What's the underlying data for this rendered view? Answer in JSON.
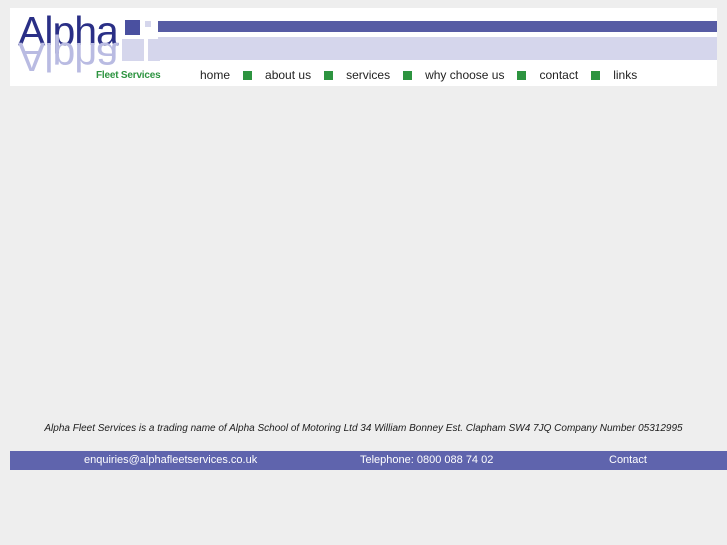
{
  "site": {
    "brand_name": "Alpha",
    "brand_tagline": "Fleet Services",
    "colors": {
      "brand_dark_blue": "#2a2f86",
      "brand_mirror": "#b9bbe2",
      "brand_green": "#2d9440",
      "bar_dark": "#575ca4",
      "bar_light": "#d5d6ec",
      "footer_bar": "#5f64ad",
      "page_background": "#eeeeee",
      "header_background": "#ffffff"
    }
  },
  "nav": {
    "items": [
      {
        "label": "home"
      },
      {
        "label": "about us"
      },
      {
        "label": "services"
      },
      {
        "label": "why choose us"
      },
      {
        "label": "contact"
      },
      {
        "label": "links"
      }
    ],
    "separator_icon": "green-square-icon"
  },
  "main": {
    "content": ""
  },
  "legal": {
    "text": "Alpha Fleet Services is a trading name of Alpha School of Motoring Ltd 34 William Bonney Est. Clapham SW4 7JQ Company Number 05312995"
  },
  "footer": {
    "email": "enquiries@alphafleetservices.co.uk",
    "telephone": "Telephone: 0800 088 74 02",
    "contact_label": "Contact"
  }
}
